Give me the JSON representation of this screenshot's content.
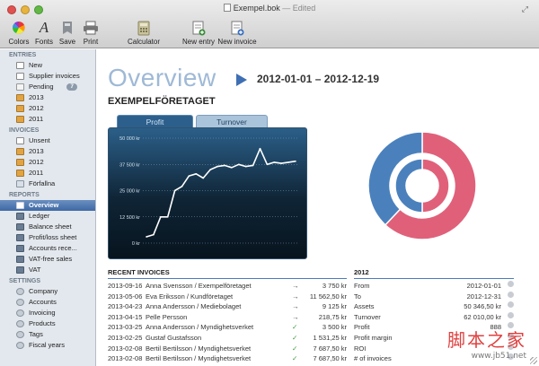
{
  "window": {
    "title": "Exempel.bok",
    "status": "— Edited"
  },
  "toolbar": [
    {
      "label": "Colors",
      "icon": "color-wheel-icon"
    },
    {
      "label": "Fonts",
      "icon": "font-icon"
    },
    {
      "label": "Save",
      "icon": "save-icon"
    },
    {
      "label": "Print",
      "icon": "printer-icon"
    },
    {
      "label": "Calculator",
      "icon": "calculator-icon"
    },
    {
      "label": "New entry",
      "icon": "new-entry-icon"
    },
    {
      "label": "New invoice",
      "icon": "new-invoice-icon"
    }
  ],
  "sidebar": {
    "entries_title": "ENTRIES",
    "entries": [
      {
        "label": "New",
        "icon": "new-doc-icon"
      },
      {
        "label": "Supplier invoices",
        "icon": "supplier-invoice-icon"
      },
      {
        "label": "Pending",
        "icon": "pending-icon",
        "badge": "7"
      },
      {
        "label": "2013",
        "icon": "folder-icon"
      },
      {
        "label": "2012",
        "icon": "folder-icon"
      },
      {
        "label": "2011",
        "icon": "folder-icon"
      }
    ],
    "invoices_title": "INVOICES",
    "invoices": [
      {
        "label": "Unsent",
        "icon": "unsent-icon"
      },
      {
        "label": "2013",
        "icon": "folder-icon"
      },
      {
        "label": "2012",
        "icon": "folder-icon"
      },
      {
        "label": "2011",
        "icon": "folder-icon"
      },
      {
        "label": "Förfallna",
        "icon": "overdue-icon"
      }
    ],
    "reports_title": "REPORTS",
    "reports": [
      {
        "label": "Overview",
        "icon": "overview-icon",
        "selected": true
      },
      {
        "label": "Ledger",
        "icon": "ledger-icon"
      },
      {
        "label": "Balance sheet",
        "icon": "balance-sheet-icon"
      },
      {
        "label": "Profit/loss sheet",
        "icon": "profit-loss-icon"
      },
      {
        "label": "Accounts rece...",
        "icon": "accounts-receivable-icon"
      },
      {
        "label": "VAT-free sales",
        "icon": "vat-free-icon"
      },
      {
        "label": "VAT",
        "icon": "vat-icon"
      }
    ],
    "settings_title": "SETTINGS",
    "settings": [
      {
        "label": "Company",
        "icon": "company-icon"
      },
      {
        "label": "Accounts",
        "icon": "accounts-icon"
      },
      {
        "label": "Invoicing",
        "icon": "invoicing-icon"
      },
      {
        "label": "Products",
        "icon": "products-icon"
      },
      {
        "label": "Tags",
        "icon": "tags-icon"
      },
      {
        "label": "Fiscal years",
        "icon": "fiscal-years-icon"
      }
    ]
  },
  "main": {
    "title": "Overview",
    "date_range": "2012-01-01 – 2012-12-19",
    "company": "EXEMPELFÖRETAGET",
    "tabs": [
      "Profit",
      "Turnover"
    ],
    "recent_title": "RECENT INVOICES",
    "invoices": [
      {
        "date": "2013-09-16",
        "customer": "Anna Svensson / Exempelföretaget",
        "status": "→",
        "amount": "3 750 kr"
      },
      {
        "date": "2013-05-06",
        "customer": "Eva Eriksson / Kundföretaget",
        "status": "→",
        "amount": "11 562,50 kr"
      },
      {
        "date": "2013-04-23",
        "customer": "Anna Andersson / Mediebolaget",
        "status": "→",
        "amount": "9 125 kr"
      },
      {
        "date": "2013-04-15",
        "customer": "Pelle Persson",
        "status": "→",
        "amount": "218,75 kr"
      },
      {
        "date": "2013-03-25",
        "customer": "Anna Andersson / Myndighetsverket",
        "status": "✓",
        "amount": "3 500 kr"
      },
      {
        "date": "2013-02-25",
        "customer": "Gustaf Gustafsson",
        "status": "✓",
        "amount": "1 531,25 kr"
      },
      {
        "date": "2013-02-08",
        "customer": "Bertil Bertilsson / Myndighetsverket",
        "status": "✓",
        "amount": "7 687,50 kr"
      },
      {
        "date": "2013-02-08",
        "customer": "Bertil Bertilsson / Myndighetsverket",
        "status": "✓",
        "amount": "7 687,50 kr"
      }
    ],
    "stats_title": "2012",
    "stats": [
      {
        "label": "From",
        "value": "2012-01-01"
      },
      {
        "label": "To",
        "value": "2012-12-31"
      },
      {
        "label": "Assets",
        "value": "50 346,50 kr"
      },
      {
        "label": "Turnover",
        "value": "62 010,00 kr"
      },
      {
        "label": "Profit",
        "value": "888"
      },
      {
        "label": "Profit margin",
        "value": ""
      },
      {
        "label": "ROI",
        "value": ""
      },
      {
        "label": "# of invoices",
        "value": ""
      }
    ]
  },
  "chart_data": [
    {
      "type": "line",
      "series": [
        {
          "values": [
            3000,
            4000,
            12500,
            12500,
            25000,
            27000,
            32000,
            33000,
            31000,
            35000,
            36500,
            37000,
            36000,
            37500,
            36500,
            37000,
            45000,
            37500,
            38500,
            38000,
            38500,
            39000
          ]
        }
      ],
      "ylim": [
        0,
        50000
      ],
      "yticks": [
        "50 000 kr",
        "37 500 kr",
        "25 000 kr",
        "12 500 kr",
        "0 kr"
      ],
      "line_color": "#ffffff"
    },
    {
      "type": "pie",
      "style": "double-donut",
      "rings": [
        {
          "name": "outer",
          "slices": [
            {
              "value": 62,
              "color": "#e0607a"
            },
            {
              "value": 38,
              "color": "#4a81bd"
            }
          ]
        },
        {
          "name": "inner",
          "slices": [
            {
              "value": 50,
              "color": "#e0607a"
            },
            {
              "value": 50,
              "color": "#4a81bd"
            }
          ]
        }
      ]
    }
  ],
  "watermark": {
    "cn": "脚本之家",
    "url": "www.jb51.net"
  },
  "colors": {
    "accent": "#3e6fb3",
    "title": "#9fb9d6",
    "pink": "#e0607a",
    "blue": "#4a81bd"
  }
}
